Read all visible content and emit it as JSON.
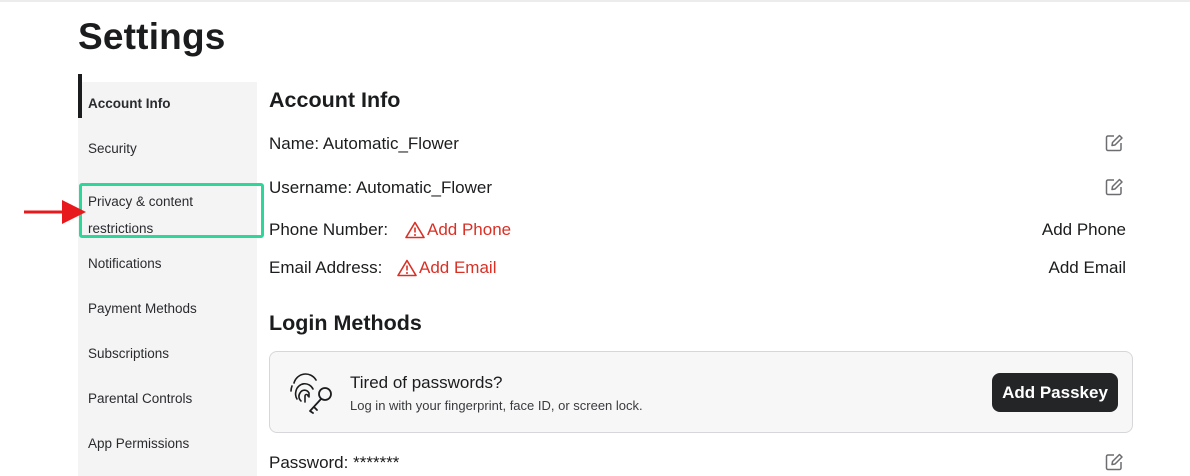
{
  "page": {
    "title": "Settings"
  },
  "sidebar": {
    "items": [
      {
        "label": "Account Info",
        "active": true
      },
      {
        "label": "Security"
      },
      {
        "label_line1": "Privacy & content",
        "label_line2": "restrictions",
        "highlighted": true
      },
      {
        "label": "Notifications"
      },
      {
        "label": "Payment Methods"
      },
      {
        "label": "Subscriptions"
      },
      {
        "label": "Parental Controls"
      },
      {
        "label": "App Permissions"
      }
    ]
  },
  "annotation": {
    "arrow_color": "#e8191c",
    "box_color": "#2fd69a"
  },
  "account_info": {
    "title": "Account Info",
    "name_label": "Name:",
    "name_value": "Automatic_Flower",
    "username_label": "Username:",
    "username_value": "Automatic_Flower",
    "phone_label": "Phone Number:",
    "phone_warning": "Add Phone",
    "phone_action": "Add Phone",
    "email_label": "Email Address:",
    "email_warning": "Add Email",
    "email_action": "Add Email"
  },
  "login_methods": {
    "title": "Login Methods",
    "passkey_title": "Tired of passwords?",
    "passkey_subtitle": "Log in with your fingerprint, face ID, or screen lock.",
    "passkey_button": "Add Passkey",
    "password_label": "Password:",
    "password_value": "*******"
  },
  "colors": {
    "warning": "#d93025",
    "button_dark": "#232527"
  },
  "icons": [
    "edit-icon",
    "warning-triangle-icon",
    "fingerprint-key-icon",
    "red-arrow-icon"
  ]
}
